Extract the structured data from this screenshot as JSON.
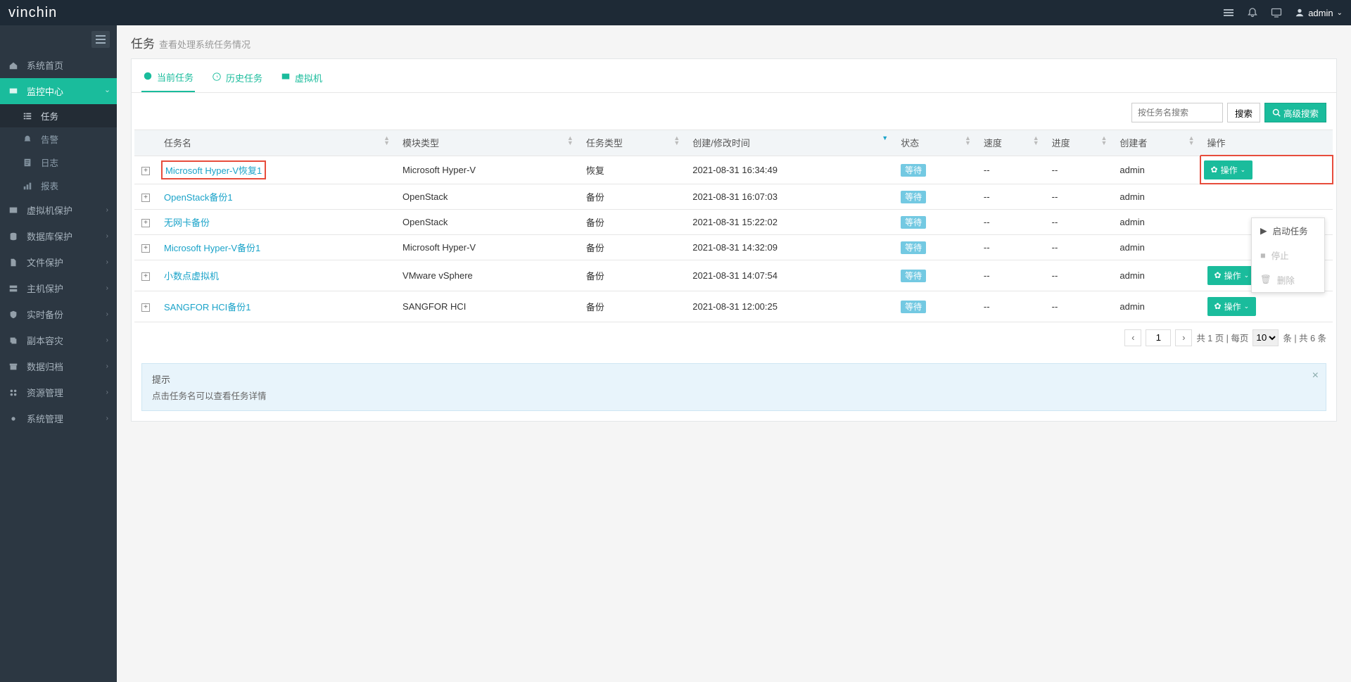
{
  "brand": "vinchin",
  "user": "admin",
  "page": {
    "title": "任务",
    "subtitle": "查看处理系统任务情况"
  },
  "sidebar": {
    "items": [
      {
        "label": "系统首页",
        "icon": "home"
      },
      {
        "label": "监控中心",
        "icon": "monitor",
        "active": true,
        "children": [
          {
            "label": "任务",
            "icon": "list",
            "active": true
          },
          {
            "label": "告警",
            "icon": "bell"
          },
          {
            "label": "日志",
            "icon": "doc"
          },
          {
            "label": "报表",
            "icon": "report"
          }
        ]
      },
      {
        "label": "虚拟机保护",
        "icon": "vm"
      },
      {
        "label": "数据库保护",
        "icon": "db"
      },
      {
        "label": "文件保护",
        "icon": "file"
      },
      {
        "label": "主机保护",
        "icon": "host"
      },
      {
        "label": "实时备份",
        "icon": "shield"
      },
      {
        "label": "副本容灾",
        "icon": "copy"
      },
      {
        "label": "数据归档",
        "icon": "archive"
      },
      {
        "label": "资源管理",
        "icon": "resource"
      },
      {
        "label": "系统管理",
        "icon": "gear"
      }
    ]
  },
  "tabs": [
    {
      "label": "当前任务",
      "icon": "dashboard",
      "active": true
    },
    {
      "label": "历史任务",
      "icon": "history"
    },
    {
      "label": "虚拟机",
      "icon": "vm"
    }
  ],
  "search": {
    "placeholder": "按任务名搜索",
    "search_btn": "搜索",
    "adv_btn": "高级搜索"
  },
  "columns": {
    "name": "任务名",
    "module": "模块类型",
    "type": "任务类型",
    "time": "创建/修改时间",
    "status": "状态",
    "speed": "速度",
    "progress": "进度",
    "creator": "创建者",
    "action": "操作"
  },
  "action_label": "操作",
  "rows": [
    {
      "name": "Microsoft Hyper-V恢复1",
      "module": "Microsoft Hyper-V",
      "type": "恢复",
      "time": "2021-08-31 16:34:49",
      "status": "等待",
      "speed": "--",
      "progress": "--",
      "creator": "admin",
      "highlight": true
    },
    {
      "name": "OpenStack备份1",
      "module": "OpenStack",
      "type": "备份",
      "time": "2021-08-31 16:07:03",
      "status": "等待",
      "speed": "--",
      "progress": "--",
      "creator": "admin"
    },
    {
      "name": "无网卡备份",
      "module": "OpenStack",
      "type": "备份",
      "time": "2021-08-31 15:22:02",
      "status": "等待",
      "speed": "--",
      "progress": "--",
      "creator": "admin"
    },
    {
      "name": "Microsoft Hyper-V备份1",
      "module": "Microsoft Hyper-V",
      "type": "备份",
      "time": "2021-08-31 14:32:09",
      "status": "等待",
      "speed": "--",
      "progress": "--",
      "creator": "admin"
    },
    {
      "name": "小数点虚拟机",
      "module": "VMware vSphere",
      "type": "备份",
      "time": "2021-08-31 14:07:54",
      "status": "等待",
      "speed": "--",
      "progress": "--",
      "creator": "admin"
    },
    {
      "name": "SANGFOR HCI备份1",
      "module": "SANGFOR HCI",
      "type": "备份",
      "time": "2021-08-31 12:00:25",
      "status": "等待",
      "speed": "--",
      "progress": "--",
      "creator": "admin"
    }
  ],
  "dropdown": {
    "start": "启动任务",
    "stop": "停止",
    "delete": "删除"
  },
  "pager": {
    "page": "1",
    "total_pages_label": "共 1 页 | 每页",
    "per_page": "10",
    "tail": "条 | 共 6 条"
  },
  "tip": {
    "title": "提示",
    "body": "点击任务名可以查看任务详情"
  }
}
